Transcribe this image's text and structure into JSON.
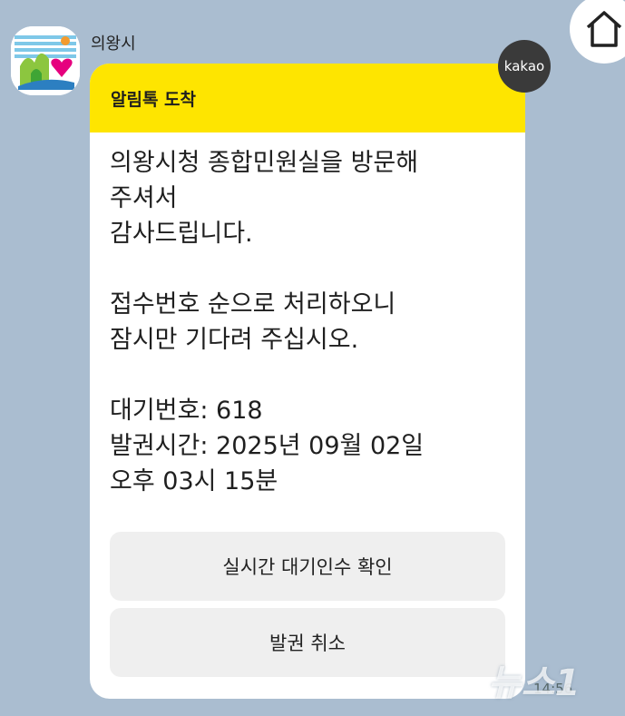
{
  "chat": {
    "sender_name": "의왕시",
    "time": "14:56"
  },
  "kakao_badge": "kakao",
  "message": {
    "header_title": "알림톡 도착",
    "paragraphs": [
      [
        "의왕시청 종합민원실을 방문해",
        "주셔서",
        "감사드립니다."
      ],
      [
        "접수번호 순으로 처리하오니",
        "잠시만 기다려 주십시오."
      ],
      [
        "대기번호: 618",
        "발권시간: 2025년 09월 02일",
        "오후 03시 15분"
      ]
    ],
    "buttons": [
      "실시간 대기인수 확인",
      "발권 취소"
    ]
  },
  "watermark": "뉴스1",
  "colors": {
    "background": "#aabdd0",
    "header_yellow": "#fee500",
    "button_gray": "#efefef"
  },
  "icons": {
    "home": "home-icon",
    "avatar": "city-logo-icon"
  }
}
